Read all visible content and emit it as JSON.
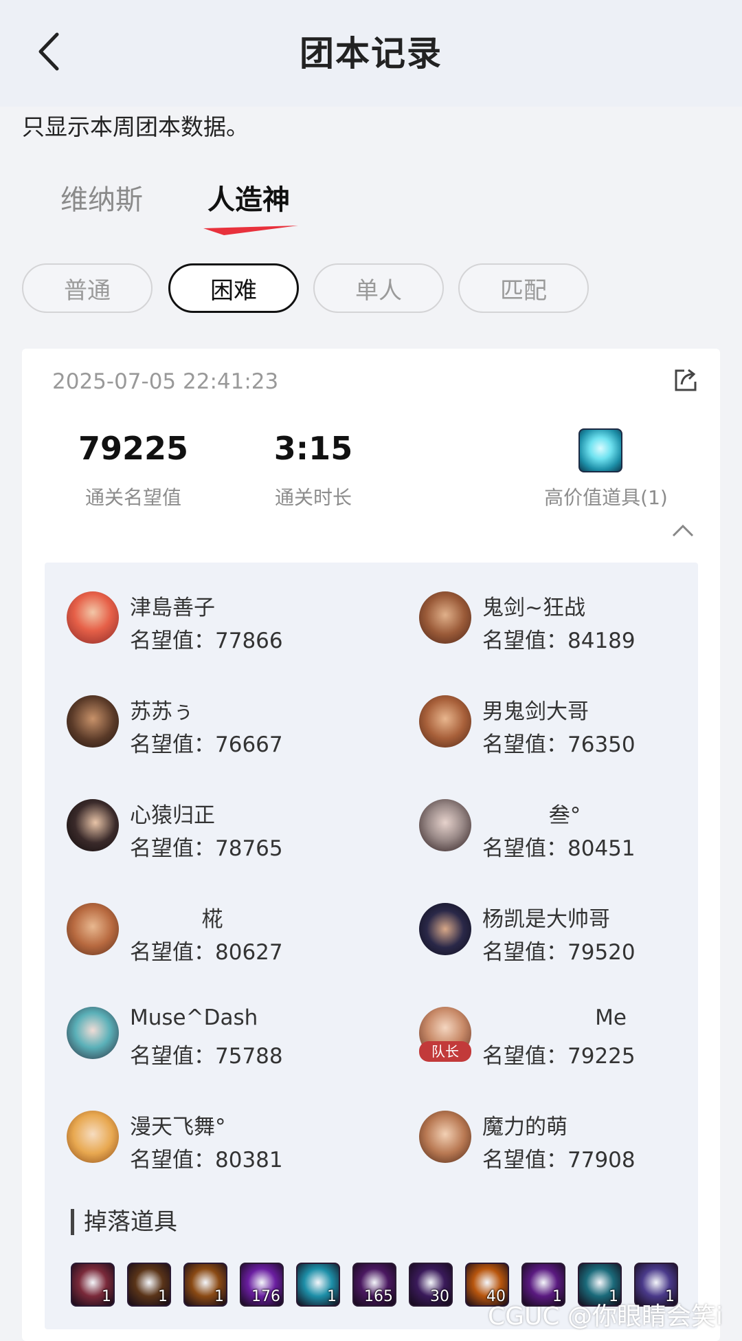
{
  "header": {
    "title": "团本记录"
  },
  "notice": "只显示本周团本数据。",
  "tabs": [
    {
      "label": "维纳斯",
      "active": false
    },
    {
      "label": "人造神",
      "active": true
    }
  ],
  "difficulty": [
    {
      "label": "普通",
      "active": false
    },
    {
      "label": "困难",
      "active": true
    },
    {
      "label": "单人",
      "active": false
    },
    {
      "label": "匹配",
      "active": false
    }
  ],
  "record": {
    "datetime": "2025-07-05 22:41:23",
    "clear_reputation": "79225",
    "clear_reputation_label": "通关名望值",
    "clear_time": "3:15",
    "clear_time_label": "通关时长",
    "high_value_label": "高价值道具(1)",
    "members": [
      {
        "name": "津島善子",
        "rep_label": "名望值：",
        "rep": "77866"
      },
      {
        "name": "鬼剑~狂战",
        "rep_label": "名望值：",
        "rep": "84189"
      },
      {
        "name": "苏苏ぅ",
        "rep_label": "名望值：",
        "rep": "76667"
      },
      {
        "name": "男鬼剑大哥",
        "rep_label": "名望值：",
        "rep": "76350"
      },
      {
        "name": "心猿归正",
        "rep_label": "名望值：",
        "rep": "78765"
      },
      {
        "name": "叁°",
        "rep_label": "名望值：",
        "rep": "80451"
      },
      {
        "name": "椛",
        "rep_label": "名望值：",
        "rep": "80627"
      },
      {
        "name": "杨凯是大帅哥",
        "rep_label": "名望值：",
        "rep": "79520"
      },
      {
        "name": "Muse^Dash",
        "rep_label": "名望值：",
        "rep": "75788"
      },
      {
        "name": "Me",
        "rep_label": "名望值：",
        "rep": "79225",
        "badge": "队长"
      },
      {
        "name": "漫天飞舞°",
        "rep_label": "名望值：",
        "rep": "80381"
      },
      {
        "name": "魔力的萌",
        "rep_label": "名望值：",
        "rep": "77908"
      }
    ],
    "drops_title": "掉落道具",
    "drops": [
      {
        "count": "1",
        "color": "#7a2a3a"
      },
      {
        "count": "1",
        "color": "#5a3418"
      },
      {
        "count": "1",
        "color": "#8a4a14"
      },
      {
        "count": "176",
        "color": "#6a1ea0"
      },
      {
        "count": "1",
        "color": "#1d8fa8"
      },
      {
        "count": "165",
        "color": "#4a1860"
      },
      {
        "count": "30",
        "color": "#3a1a5a"
      },
      {
        "count": "40",
        "color": "#b8560e"
      },
      {
        "count": "1",
        "color": "#5a1a80"
      },
      {
        "count": "1",
        "color": "#1a6a7a"
      },
      {
        "count": "1",
        "color": "#4a3a8a"
      }
    ]
  },
  "watermark": "CGUC @你眼睛会笑i",
  "colors": {
    "accent": "#e8313c",
    "panel": "#eff2f8",
    "page": "#f2f3f6"
  }
}
